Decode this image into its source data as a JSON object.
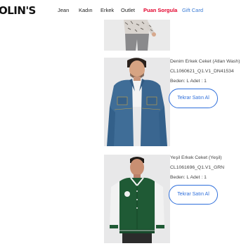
{
  "brand": {
    "logo_text": "OLIN'S"
  },
  "nav": {
    "items": [
      {
        "label": "Jean"
      },
      {
        "label": "Kadın"
      },
      {
        "label": "Erkek"
      },
      {
        "label": "Outlet"
      },
      {
        "label": "Puan Sorgula"
      },
      {
        "label": "Gift Card"
      }
    ]
  },
  "orders": [
    {
      "name": "Denim Erkek Ceket (Atlan Wash)",
      "code": "CL1060621_Q1.V1_DN41534",
      "quantity": "Beden: L Adet : 1",
      "button": "Tekrar Satın Al"
    },
    {
      "name": "Yeşil Erkek Ceket (Yeşil)",
      "code": "CL1061696_Q1.V1_GRN",
      "quantity": "Beden: L Adet : 1",
      "button": "Tekrar Satın Al"
    }
  ],
  "colors": {
    "accent": "#2f6fdb",
    "highlight": "#e3002b",
    "gift": "#3a7bd5"
  }
}
